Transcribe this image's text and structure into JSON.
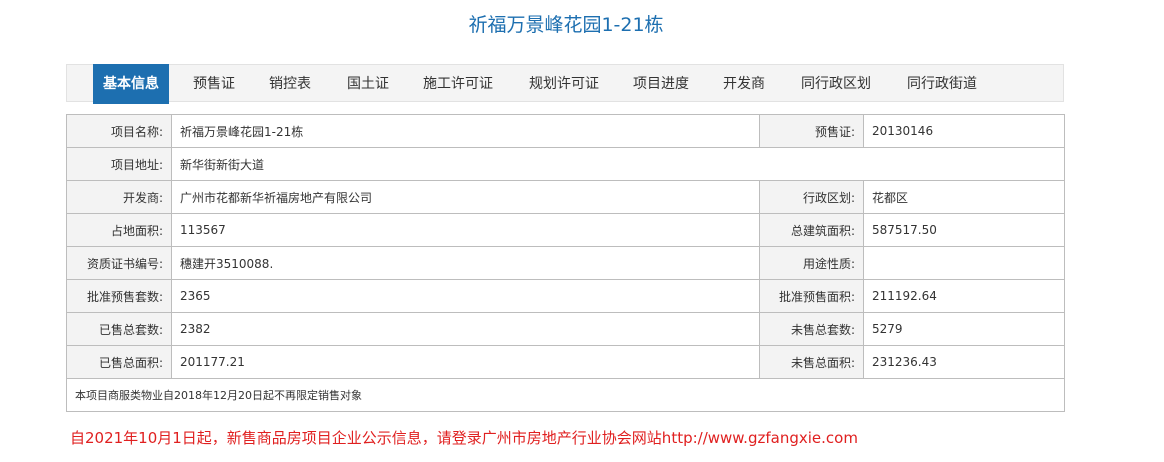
{
  "page": {
    "title": "祈福万景峰花园1-21栋"
  },
  "tabs": [
    {
      "label": "基本信息",
      "active": true
    },
    {
      "label": "预售证",
      "active": false
    },
    {
      "label": "销控表",
      "active": false
    },
    {
      "label": "国土证",
      "active": false
    },
    {
      "label": "施工许可证",
      "active": false
    },
    {
      "label": "规划许可证",
      "active": false
    },
    {
      "label": "项目进度",
      "active": false
    },
    {
      "label": "开发商",
      "active": false
    },
    {
      "label": "同行政区划",
      "active": false
    },
    {
      "label": "同行政街道",
      "active": false
    }
  ],
  "info": {
    "project_name_label": "项目名称:",
    "project_name": "祈福万景峰花园1-21栋",
    "presale_cert_label": "预售证:",
    "presale_cert": "20130146",
    "address_label": "项目地址:",
    "address": "新华街新街大道",
    "developer_label": "开发商:",
    "developer": "广州市花都新华祈福房地产有限公司",
    "district_label": "行政区划:",
    "district": "花都区",
    "land_area_label": "占地面积:",
    "land_area": "113567",
    "total_build_area_label": "总建筑面积:",
    "total_build_area": "587517.50",
    "qualification_label": "资质证书编号:",
    "qualification": "穗建开3510088.",
    "usage_label": "用途性质:",
    "usage": "",
    "approved_units_label": "批准预售套数:",
    "approved_units": "2365",
    "approved_area_label": "批准预售面积:",
    "approved_area": "211192.64",
    "sold_units_label": "已售总套数:",
    "sold_units": "2382",
    "unsold_units_label": "未售总套数:",
    "unsold_units": "5279",
    "sold_area_label": "已售总面积:",
    "sold_area": "201177.21",
    "unsold_area_label": "未售总面积:",
    "unsold_area": "231236.43",
    "note": "本项目商服类物业自2018年12月20日起不再限定销售对象"
  },
  "notice": "自2021年10月1日起，新售商品房项目企业公示信息，请登录广州市房地产行业协会网站http://www.gzfangxie.com",
  "colors": {
    "accent": "#1d6fb0",
    "notice": "#e02020",
    "label_bg": "#f3f3f3",
    "border": "#bdbdbd"
  }
}
